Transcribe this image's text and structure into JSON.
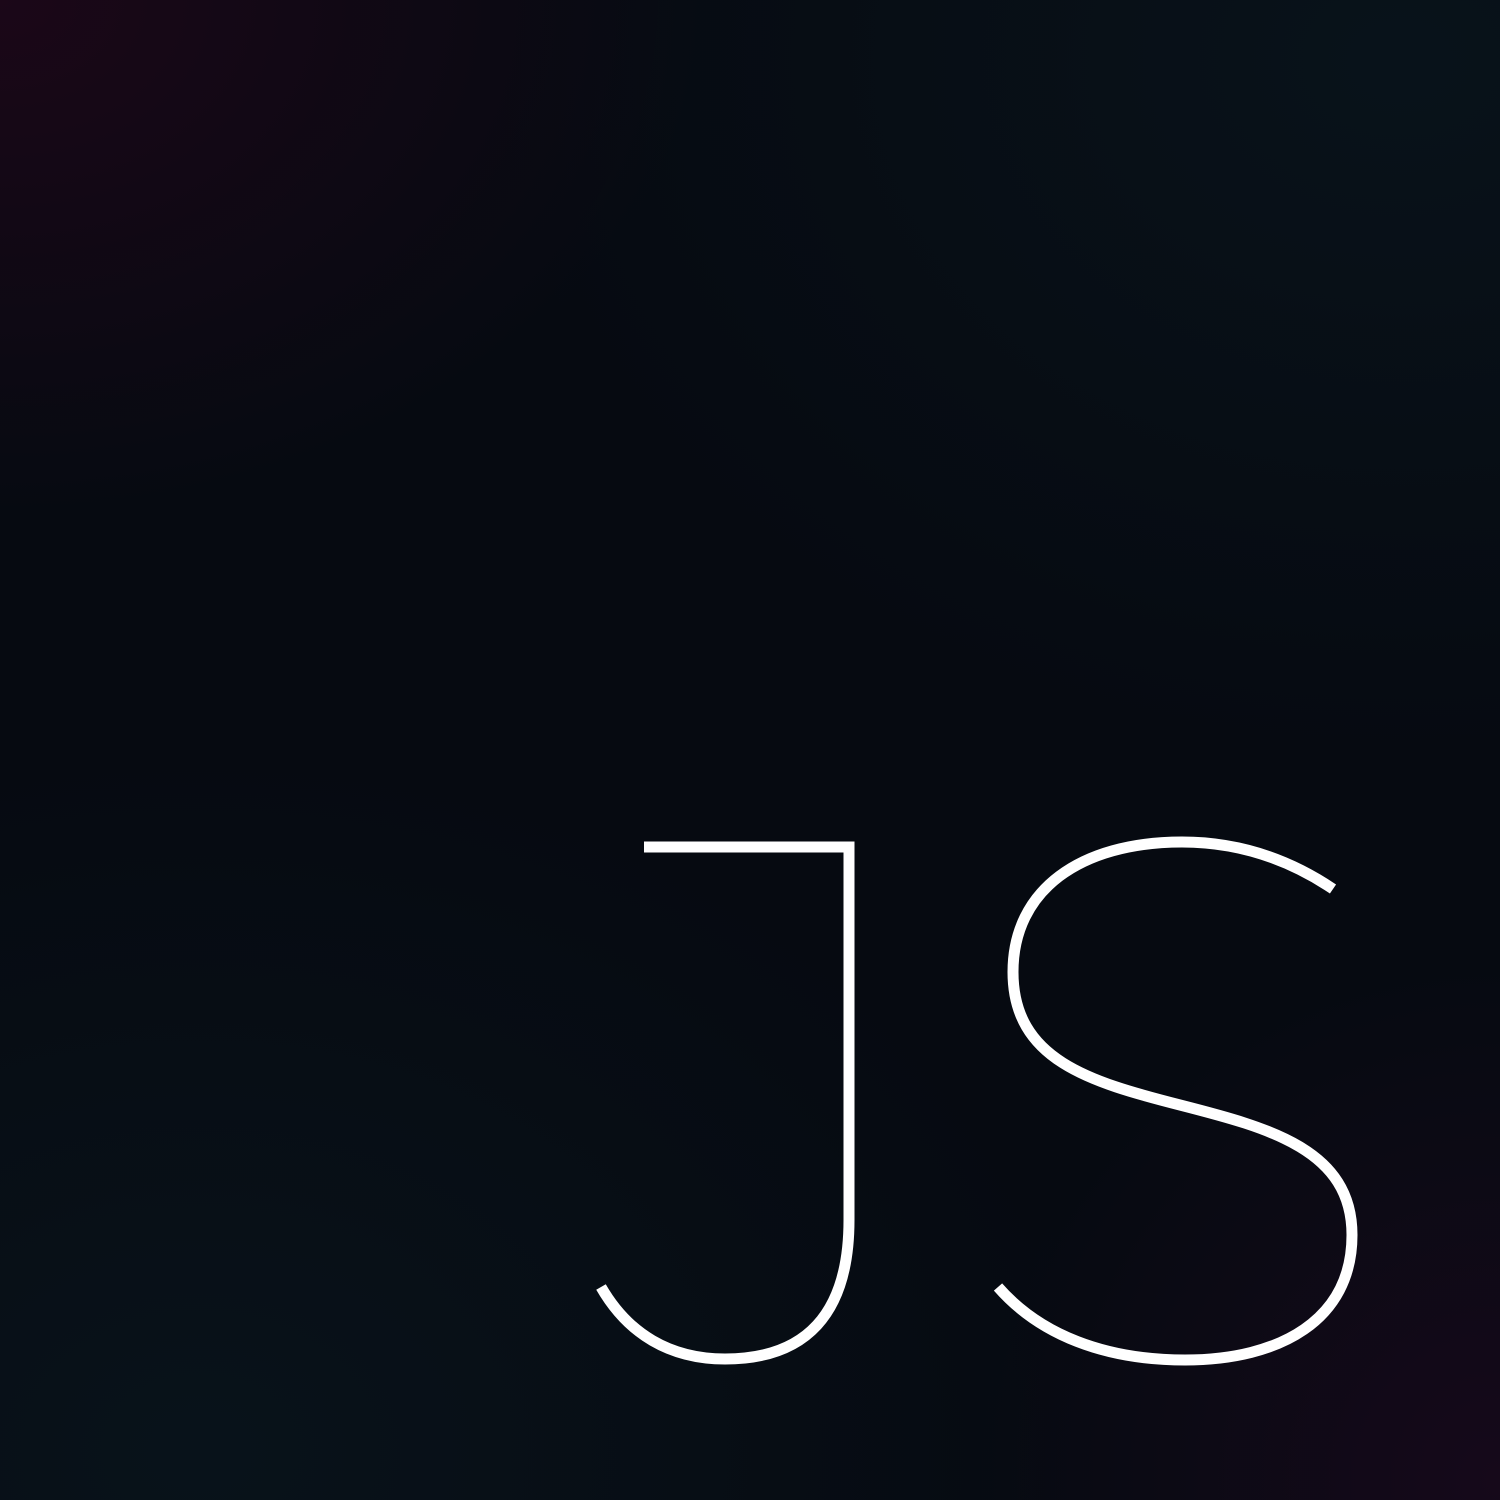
{
  "logo": {
    "text": "JS",
    "stroke_color": "#ffffff"
  },
  "background": {
    "base_color": "#060a11",
    "glow_top_left": "#22061a",
    "glow_bottom_right": "#230822"
  }
}
